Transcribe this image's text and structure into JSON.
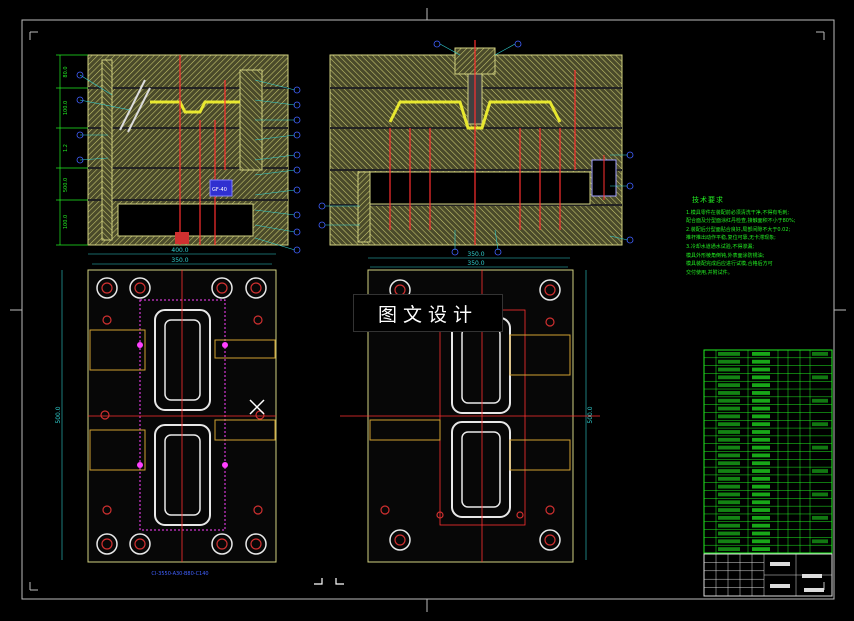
{
  "watermark": "图文设计",
  "notes": {
    "title": "技术要求",
    "lines": [
      "1.模具零件在装配前必须清洗干净,不得有毛刺;",
      "配合面及分型面涂红丹检查,接触面积不小于80%;",
      "2.装配后分型面贴合良好,局部间隙不大于0.02;",
      "推杆推出动作平稳,复位可靠,无卡滞现象;",
      "3.冷却水道通水试验,不得渗漏;",
      "模具外形棱角倒钝,外表面涂防锈油;",
      "模具装配完成后应进行试模,合格后方可",
      "交付使用,并附试件。"
    ]
  },
  "dims": {
    "left_width_1": "400.0",
    "left_width_2": "350.0",
    "left_height": "500.0",
    "right_width_1": "350.0",
    "right_width_2": "350.0",
    "right_height": "500.0",
    "side_heights": [
      "80.0",
      "100.0",
      "1.2",
      "500.0",
      "100.0",
      "200.0"
    ],
    "part_label": "GF-40",
    "spec_text": "CI-3550-A30-B80-C140"
  },
  "corner_marks": [
    "L",
    "L"
  ]
}
